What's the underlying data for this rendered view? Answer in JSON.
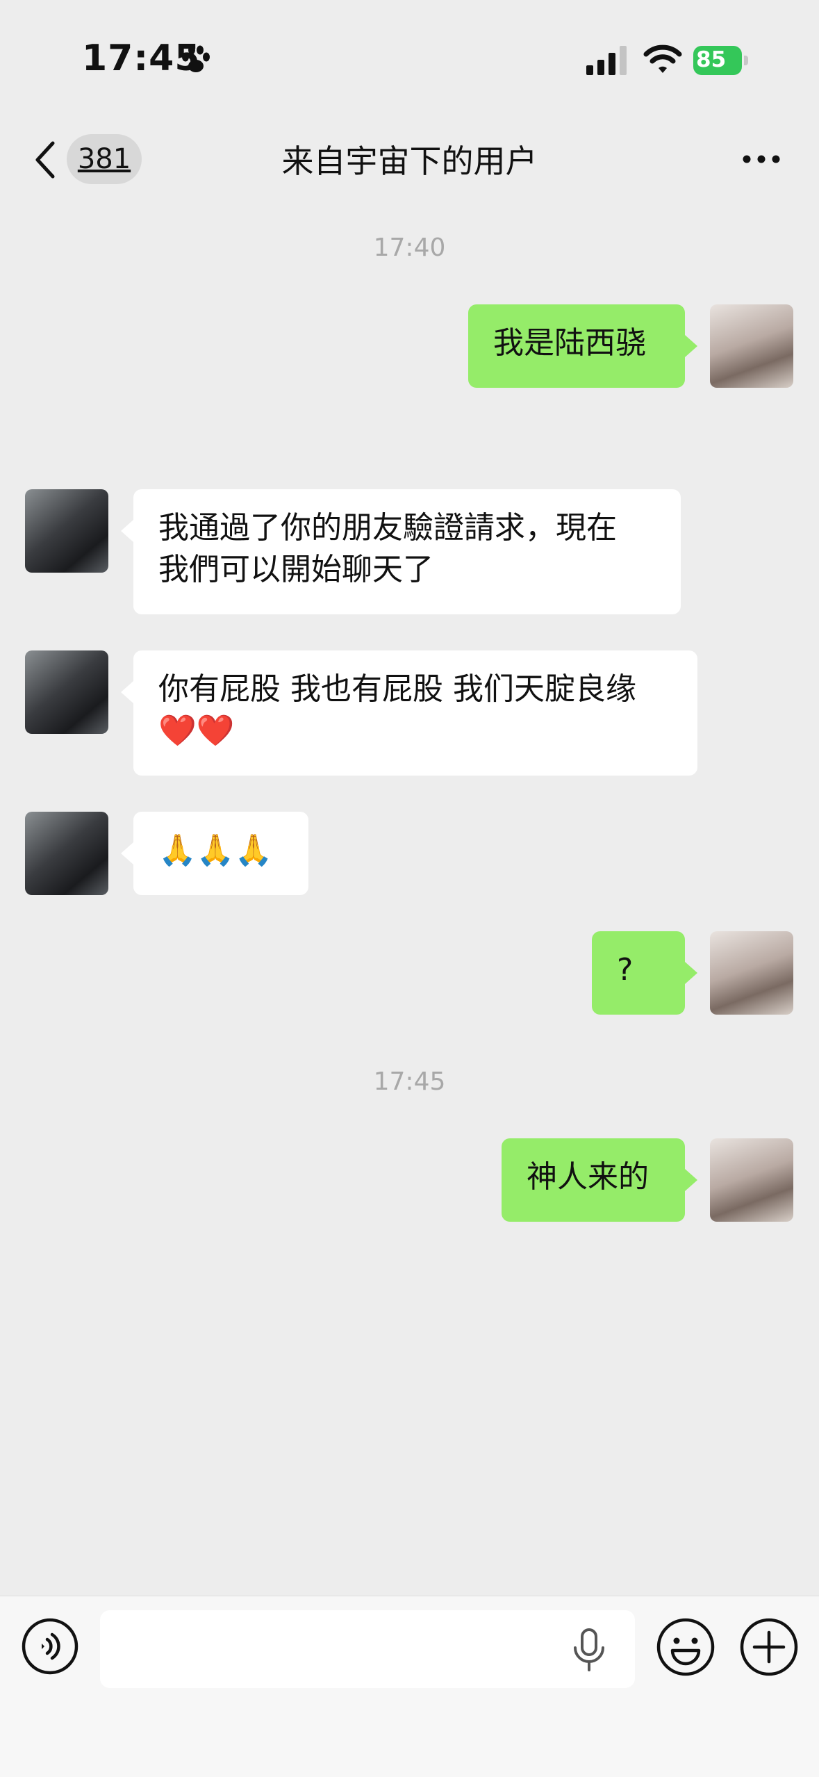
{
  "status_bar": {
    "time": "17:45",
    "battery": "85"
  },
  "nav": {
    "unread_count": "381",
    "title": "来自宇宙下的用户"
  },
  "messages": [
    {
      "type": "timestamp",
      "text": "17:40"
    },
    {
      "type": "sent",
      "text": "我是陆西骁"
    },
    {
      "type": "received",
      "text": "我通過了你的朋友驗證請求，現在\n我們可以開始聊天了"
    },
    {
      "type": "received",
      "text": "你有屁股 我也有屁股 我们天腚良缘\n❤️❤️"
    },
    {
      "type": "received",
      "text": "🙏🙏🙏"
    },
    {
      "type": "sent",
      "text": "?"
    },
    {
      "type": "timestamp",
      "text": "17:45"
    },
    {
      "type": "sent",
      "text": "神人来的"
    }
  ],
  "input": {
    "value": "",
    "placeholder": ""
  },
  "colors": {
    "sent_bubble": "#95ec69",
    "received_bubble": "#ffffff",
    "background": "#ededed",
    "battery": "#34c759"
  },
  "icons": [
    "paw-icon",
    "signal-icon",
    "wifi-icon",
    "battery-icon",
    "back-icon",
    "more-icon",
    "voice-icon",
    "mic-icon",
    "emoji-icon",
    "plus-icon"
  ]
}
